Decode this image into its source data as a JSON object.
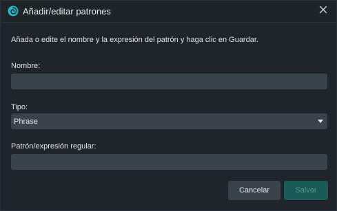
{
  "window": {
    "title": "Añadir/editar patrones",
    "app_icon": "swirl-logo-icon",
    "close_icon": "close-icon"
  },
  "instructions": "Añada o edite el nombre y la expresión del patrón y haga clic en Guardar.",
  "fields": {
    "name": {
      "label": "Nombre:",
      "value": "",
      "placeholder": ""
    },
    "type": {
      "label": "Tipo:",
      "selected": "Phrase"
    },
    "pattern": {
      "label": "Patrón/expresión regular:",
      "value": "",
      "placeholder": ""
    }
  },
  "buttons": {
    "cancel": "Cancelar",
    "save": "Salvar"
  },
  "colors": {
    "accent": "#1a5a56",
    "accent_text": "#5f9591",
    "logo": "#2fb5c9"
  }
}
